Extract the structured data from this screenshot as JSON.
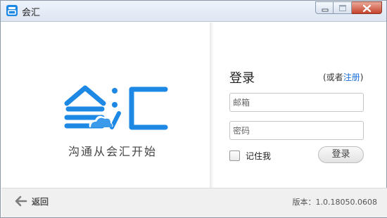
{
  "window": {
    "title": "会汇"
  },
  "brand": {
    "logo_text": "会汇",
    "slogan": "沟通从会汇开始",
    "accent_color": "#1e88e5"
  },
  "login": {
    "title": "登录",
    "alt_prefix": "(或者",
    "register_link": "注册",
    "alt_suffix": ")",
    "email_placeholder": "邮箱",
    "password_placeholder": "密码",
    "remember_label": "记住我",
    "remember_checked": false,
    "submit_label": "登录"
  },
  "footer": {
    "back_label": "返回",
    "version_text": "版本：1.0.18050.0608"
  },
  "icons": {
    "app": "app-logo-icon",
    "minimize": "minimize-icon",
    "maximize": "maximize-icon",
    "close": "close-icon",
    "back": "arrow-left-icon",
    "cloud": "cloud-icon"
  }
}
